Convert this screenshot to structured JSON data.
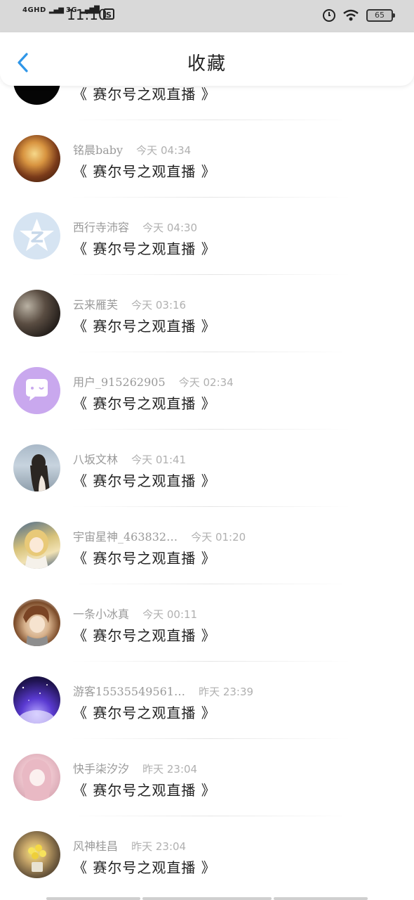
{
  "status_bar": {
    "network_1": "4GHD",
    "network_2": "3G",
    "time": "11:10",
    "sim_icon_text": "S",
    "battery": "65"
  },
  "header": {
    "back_icon": "chevron-left-icon",
    "title": "收藏"
  },
  "colors": {
    "accent": "#2f96e8",
    "status_bar_bg": "#d9d9d9",
    "meta_text": "#9a9a9a",
    "title_text": "#222222"
  },
  "items": [
    {
      "name": "",
      "time": "",
      "title": "《 赛尔号之观直播 》",
      "avatar": "black"
    },
    {
      "name": "铭晨baby",
      "time": "今天 04:34",
      "title": "《 赛尔号之观直播 》",
      "avatar": "fire"
    },
    {
      "name": "西行寺沛容",
      "time": "今天 04:30",
      "title": "《 赛尔号之观直播 》",
      "avatar": "z"
    },
    {
      "name": "云来雁芙",
      "time": "今天 03:16",
      "title": "《 赛尔号之观直播 》",
      "avatar": "clock"
    },
    {
      "name": "用户_915262905",
      "time": "今天 02:34",
      "title": "《 赛尔号之观直播 》",
      "avatar": "chat"
    },
    {
      "name": "八坂文林",
      "time": "今天 01:41",
      "title": "《 赛尔号之观直播 》",
      "avatar": "girl"
    },
    {
      "name": "宇宙星神_463832…",
      "time": "今天 01:20",
      "title": "《 赛尔号之观直播 》",
      "avatar": "anime"
    },
    {
      "name": "一条小冰真",
      "time": "今天 00:11",
      "title": "《 赛尔号之观直播 》",
      "avatar": "boy"
    },
    {
      "name": "游客15535549561…",
      "time": "昨天 23:39",
      "title": "《 赛尔号之观直播 》",
      "avatar": "space"
    },
    {
      "name": "快手柒汐汐",
      "time": "昨天 23:04",
      "title": "《 赛尔号之观直播 》",
      "avatar": "pink"
    },
    {
      "name": "风神桂昌",
      "time": "昨天 23:04",
      "title": "《 赛尔号之观直播 》",
      "avatar": "flower"
    }
  ]
}
